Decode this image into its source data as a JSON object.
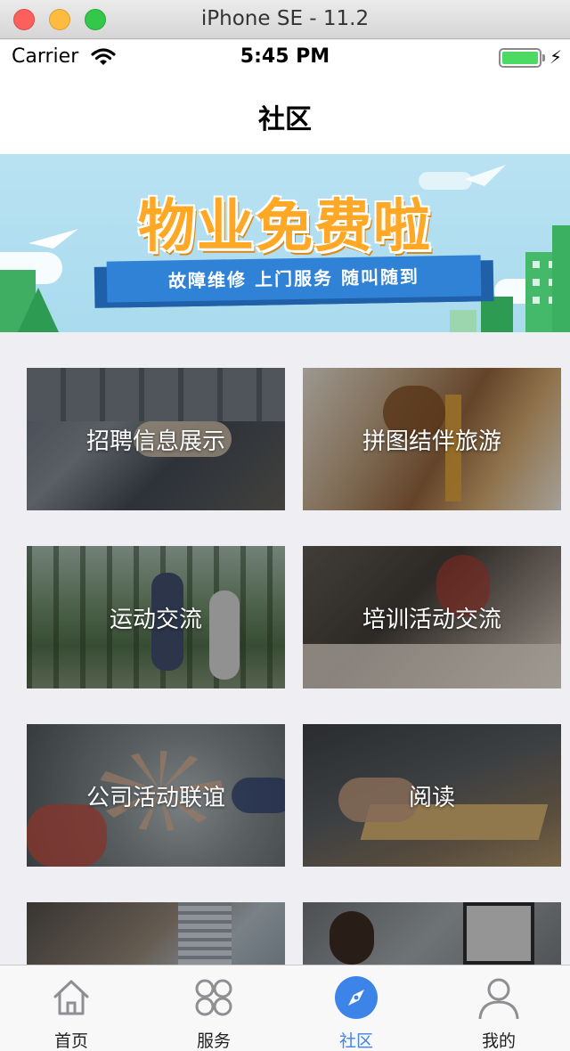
{
  "window": {
    "title": "iPhone SE - 11.2"
  },
  "status_bar": {
    "carrier": "Carrier",
    "time": "5:45 PM"
  },
  "nav": {
    "title": "社区"
  },
  "banner": {
    "headline": "物业免费啦",
    "tagline": "故障维修  上门服务  随叫随到"
  },
  "categories": [
    {
      "label": "招聘信息展示"
    },
    {
      "label": "拼图结伴旅游"
    },
    {
      "label": "运动交流"
    },
    {
      "label": "培训活动交流"
    },
    {
      "label": "公司活动联谊"
    },
    {
      "label": "阅读"
    },
    {
      "label": ""
    },
    {
      "label": ""
    }
  ],
  "tabbar": {
    "items": [
      {
        "label": "首页",
        "icon": "home-icon"
      },
      {
        "label": "服务",
        "icon": "grid-icon"
      },
      {
        "label": "社区",
        "icon": "compass-icon"
      },
      {
        "label": "我的",
        "icon": "person-icon"
      }
    ],
    "active_index": 2,
    "active_color": "#3c84e8",
    "inactive_color": "#8e8e93"
  }
}
